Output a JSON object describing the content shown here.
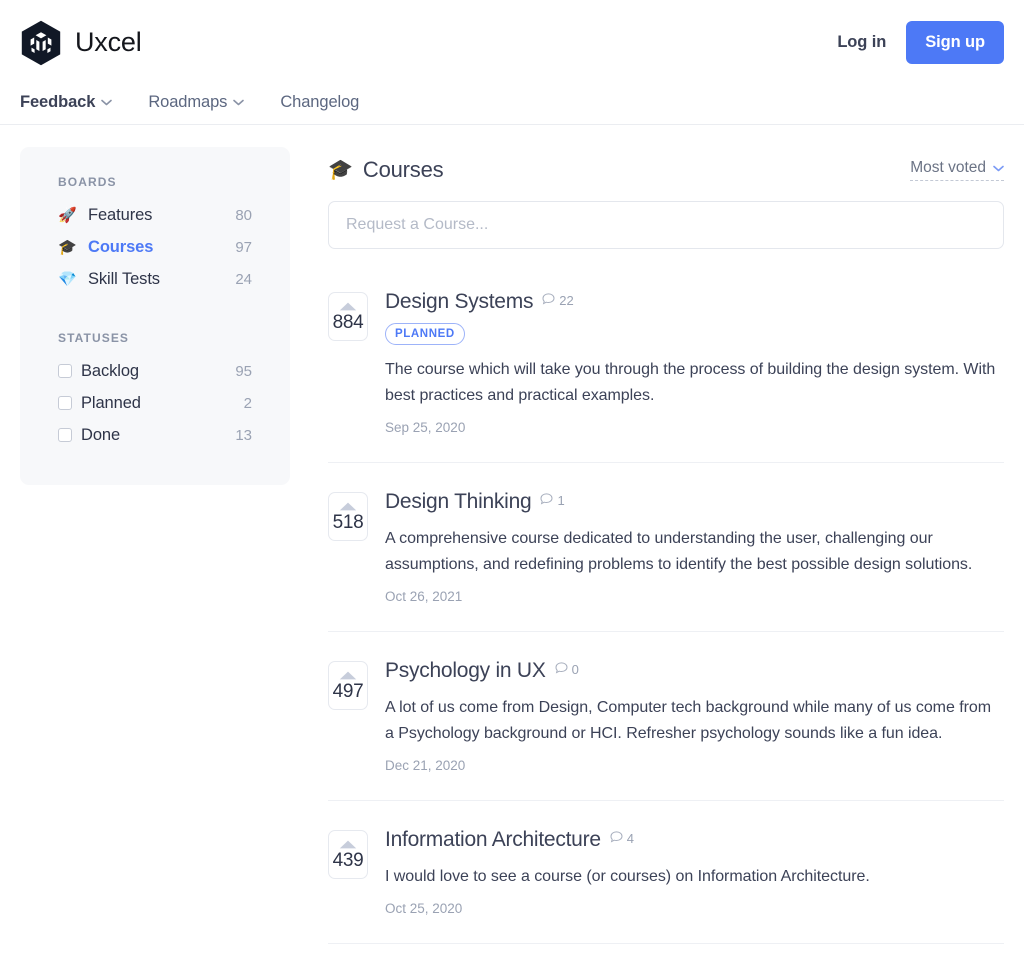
{
  "header": {
    "brand_name": "Uxcel",
    "logo_icon": "uxcel-hexagon-logo",
    "login_label": "Log in",
    "signup_label": "Sign up",
    "accent_color": "#4d79f6"
  },
  "nav": {
    "items": [
      {
        "label": "Feedback",
        "has_chevron": true,
        "active": true
      },
      {
        "label": "Roadmaps",
        "has_chevron": true,
        "active": false
      },
      {
        "label": "Changelog",
        "has_chevron": false,
        "active": false
      }
    ]
  },
  "sidebar": {
    "boards_title": "BOARDS",
    "boards": [
      {
        "emoji": "🚀",
        "icon": "rocket-icon",
        "label": "Features",
        "count": "80",
        "selected": false
      },
      {
        "emoji": "🎓",
        "icon": "graduation-cap-icon",
        "label": "Courses",
        "count": "97",
        "selected": true
      },
      {
        "emoji": "💎",
        "icon": "gem-icon",
        "label": "Skill Tests",
        "count": "24",
        "selected": false
      }
    ],
    "statuses_title": "STATUSES",
    "statuses": [
      {
        "label": "Backlog",
        "count": "95",
        "checked": false
      },
      {
        "label": "Planned",
        "count": "2",
        "checked": false
      },
      {
        "label": "Done",
        "count": "13",
        "checked": false
      }
    ]
  },
  "main": {
    "board_emoji": "🎓",
    "board_title": "Courses",
    "sort_label": "Most voted",
    "request_placeholder": "Request a Course...",
    "request_value": "",
    "posts": [
      {
        "votes": "884",
        "title": "Design Systems",
        "comments": "22",
        "status": "PLANNED",
        "description": "The course which will take you through the process of building the design system. With best practices and practical examples.",
        "date": "Sep 25, 2020"
      },
      {
        "votes": "518",
        "title": "Design Thinking",
        "comments": "1",
        "status": "",
        "description": "A comprehensive course dedicated to understanding the user, challenging our assumptions, and redefining problems to identify the best possible design solutions.",
        "date": "Oct 26, 2021"
      },
      {
        "votes": "497",
        "title": "Psychology in UX",
        "comments": "0",
        "status": "",
        "description": "A lot of us come from Design, Computer tech background while many of us come from a Psychology background or HCI. Refresher psychology sounds like a fun idea.",
        "date": "Dec 21, 2020"
      },
      {
        "votes": "439",
        "title": "Information Architecture",
        "comments": "4",
        "status": "",
        "description": "I would love to see a course (or courses) on Information Architecture.",
        "date": "Oct 25, 2020"
      }
    ]
  }
}
